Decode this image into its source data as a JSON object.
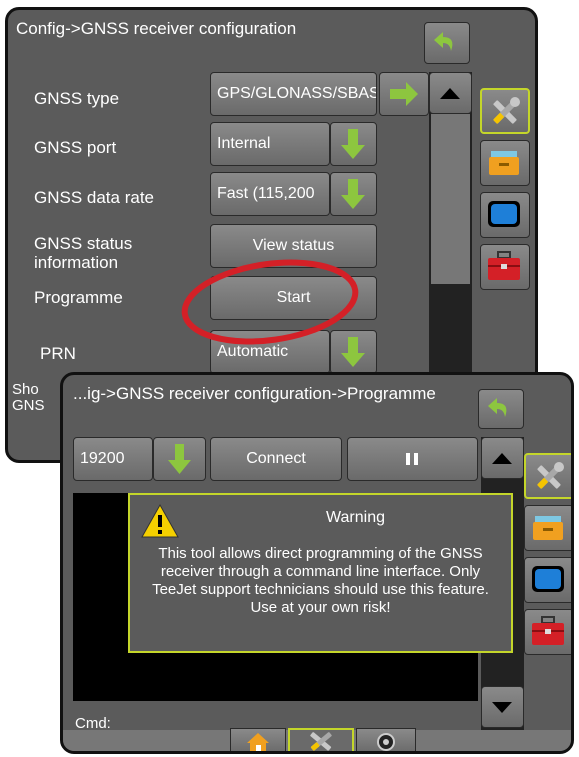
{
  "config": {
    "title": "Config->GNSS receiver configuration",
    "rows": [
      {
        "label": "GNSS type",
        "value": "GPS/GLONASS/SBAS"
      },
      {
        "label": "GNSS port",
        "value": "Internal"
      },
      {
        "label": "GNSS data rate",
        "value": "Fast (115,200"
      },
      {
        "label": "GNSS status information",
        "value": "View status"
      },
      {
        "label": "Programme",
        "value": "Start"
      },
      {
        "label": "PRN",
        "value": "Automatic"
      },
      {
        "label": "Sho GNS",
        "value": ""
      }
    ]
  },
  "programme": {
    "title": "...ig->GNSS receiver configuration->Programme",
    "baud": "19200",
    "connect_label": "Connect",
    "cmd_label": "Cmd:",
    "warning": {
      "title": "Warning",
      "text": "This tool allows direct programming of the GNSS receiver through a command line interface. Only TeeJet support technicians should use this feature. Use at your own risk!"
    }
  },
  "colors": {
    "panel": "#5b5b5b",
    "accent_green": "#8dc63f",
    "highlight": "#c4d62a",
    "annotation_red": "#d42027"
  }
}
